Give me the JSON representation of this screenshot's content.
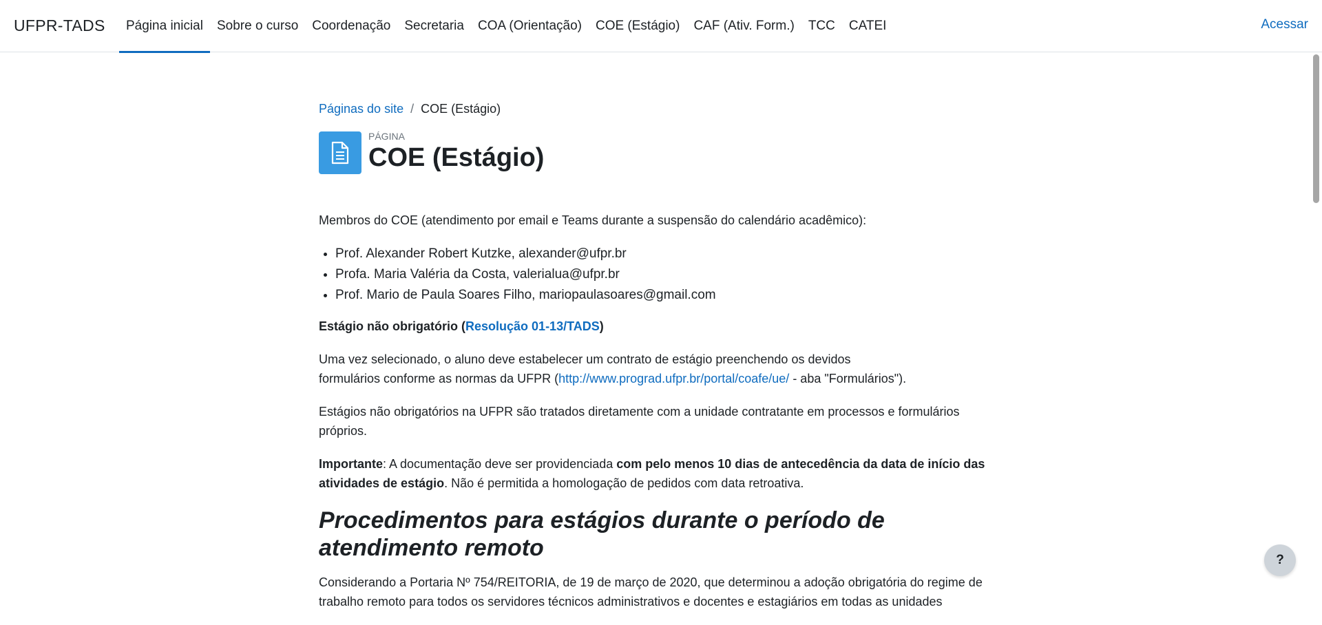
{
  "navbar": {
    "brand": "UFPR-TADS",
    "items": [
      {
        "label": "Página inicial"
      },
      {
        "label": "Sobre o curso"
      },
      {
        "label": "Coordenação"
      },
      {
        "label": "Secretaria"
      },
      {
        "label": "COA (Orientação)"
      },
      {
        "label": "COE (Estágio)"
      },
      {
        "label": "CAF (Ativ. Form.)"
      },
      {
        "label": "TCC"
      },
      {
        "label": "CATEI"
      }
    ],
    "login": "Acessar"
  },
  "breadcrumb": {
    "parent": "Páginas do site",
    "separator": "/",
    "current": "COE (Estágio)"
  },
  "header": {
    "kind": "PÁGINA",
    "title": "COE (Estágio)"
  },
  "content": {
    "intro": "Membros do COE (atendimento por email e Teams durante a suspensão do calendário acadêmico):",
    "members": [
      "Prof. Alexander Robert Kutzke, alexander@ufpr.br",
      "Profa. Maria Valéria da Costa, valerialua@ufpr.br",
      "Prof. Mario de Paula Soares Filho, mariopaulasoares@gmail.com"
    ],
    "nonmandatory_title_pre": "Estágio não obrigatório (",
    "nonmandatory_link": "Resolução 01-13/TADS",
    "nonmandatory_title_post": ")",
    "p1_line1": "Uma vez selecionado, o aluno deve estabelecer um contrato de estágio preenchendo os devidos",
    "p1_line2_pre": "formulários conforme as normas da UFPR (",
    "p1_link": "http://www.prograd.ufpr.br/portal/coafe/ue/",
    "p1_line2_post": " - aba \"Formulários\").",
    "p2": "Estágios não obrigatórios na UFPR são tratados diretamente com a unidade contratante em processos e formulários próprios.",
    "p3_label": "Importante",
    "p3_mid": ": A documentação deve ser providenciada ",
    "p3_bold": "com pelo menos 10 dias de antecedência da data de início das atividades de estágio",
    "p3_end": ". Não é permitida a homologação de pedidos com data retroativa.",
    "h3": "Procedimentos para estágios durante o período de atendimento remoto",
    "p4": "Considerando a Portaria Nº 754/REITORIA, de 19 de março de 2020, que determinou a adoção obrigatória do regime de trabalho remoto para todos os servidores técnicos administrativos e docentes e estagiários em todas as unidades"
  },
  "help": {
    "label": "?"
  }
}
